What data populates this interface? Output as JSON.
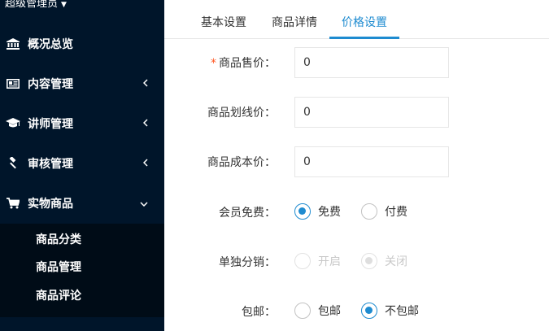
{
  "sidebar": {
    "user_name": "超级管理员",
    "items": [
      {
        "label": "概况总览",
        "icon": "bank-icon"
      },
      {
        "label": "内容管理",
        "icon": "newspaper-icon"
      },
      {
        "label": "讲师管理",
        "icon": "graduation-cap-icon"
      },
      {
        "label": "审核管理",
        "icon": "gavel-icon"
      },
      {
        "label": "实物商品",
        "icon": "shopping-cart-icon"
      }
    ],
    "sub_items": [
      {
        "label": "商品分类"
      },
      {
        "label": "商品管理"
      },
      {
        "label": "商品评论"
      }
    ]
  },
  "tabs": [
    {
      "label": "基本设置"
    },
    {
      "label": "商品详情"
    },
    {
      "label": "价格设置",
      "active": true
    }
  ],
  "form": {
    "price": {
      "label": "商品售价：",
      "value": "0",
      "required": true
    },
    "strike_price": {
      "label": "商品划线价：",
      "value": "0"
    },
    "cost_price": {
      "label": "商品成本价：",
      "value": "0"
    },
    "member_free": {
      "label": "会员免费：",
      "options": [
        "免费",
        "付费"
      ],
      "selected": "免费"
    },
    "distribution": {
      "label": "单独分销：",
      "options": [
        "开启",
        "关闭"
      ],
      "selected": "关闭",
      "disabled": true
    },
    "shipping": {
      "label": "包邮：",
      "options": [
        "包邮",
        "不包邮"
      ],
      "selected": "不包邮"
    }
  },
  "colors": {
    "accent": "#1e8bd0",
    "sidebar_bg": "#00152a",
    "submenu_bg": "#000c17",
    "required": "#ff5722"
  }
}
